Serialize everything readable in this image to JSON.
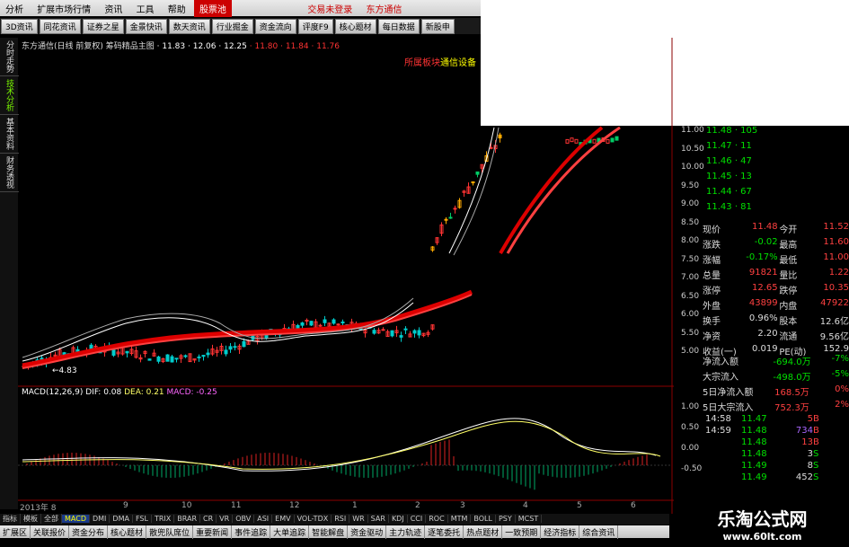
{
  "menubar": {
    "items": [
      "分析",
      "扩展市场行情",
      "资讯",
      "工具",
      "帮助"
    ],
    "highlight": "股票池",
    "right_items": [
      "交易未登录",
      "东方通信"
    ]
  },
  "tabs": [
    "3D资讯",
    "同花资讯",
    "证券之星",
    "金景快讯",
    "数天资讯",
    "行业掘金",
    "资金流向",
    "评度F9",
    "核心题材",
    "每日数据",
    "新股申"
  ],
  "sidebar": {
    "items": [
      "分时走势",
      "技术分析",
      "基本资料",
      "财务透视"
    ],
    "active_index": 1
  },
  "chart": {
    "title": "东方通信(日线 前复权) 筹码精品主图",
    "ma_values": [
      "11.83",
      "12.06",
      "12.25"
    ],
    "ma_values_red": [
      "11.80",
      "11.84",
      "11.76"
    ],
    "annotation_red": "所属板块",
    "annotation_yellow": "通信设备",
    "low_marker": "←4.83",
    "price_axis": [
      "11.00",
      "10.50",
      "10.00",
      "9.50",
      "9.00",
      "8.50",
      "8.00",
      "7.50",
      "7.00",
      "6.50",
      "6.00",
      "5.50",
      "5.00"
    ],
    "macd_label": "MACD(12,26,9)",
    "macd_dif": "DIF: 0.08",
    "macd_dea": "DEA: 0.21",
    "macd_val": "MACD: -0.25",
    "macd_axis": [
      "1.00",
      "0.50",
      "0.00",
      "-0.50"
    ],
    "date_axis": [
      "2013年 8",
      "9",
      "10",
      "11",
      "12",
      "1",
      "2",
      "3",
      "4",
      "5",
      "6"
    ]
  },
  "orderbook": {
    "rows": [
      {
        "price": "11.48",
        "vol": "105"
      },
      {
        "price": "11.47",
        "vol": "11"
      },
      {
        "price": "11.46",
        "vol": "47"
      },
      {
        "price": "11.45",
        "vol": "13"
      },
      {
        "price": "11.44",
        "vol": "67"
      },
      {
        "price": "11.43",
        "vol": "81"
      }
    ]
  },
  "quote": [
    [
      "现价",
      "11.48",
      "今开",
      "11.52"
    ],
    [
      "涨跌",
      "-0.02",
      "最高",
      "11.60"
    ],
    [
      "涨幅",
      "-0.17%",
      "最低",
      "11.00"
    ],
    [
      "总量",
      "91821",
      "量比",
      "1.22"
    ],
    [
      "涨停",
      "12.65",
      "跌停",
      "10.35"
    ],
    [
      "外盘",
      "43899",
      "内盘",
      "47922"
    ],
    [
      "换手",
      "0.96%",
      "股本",
      "12.6亿"
    ],
    [
      "净资",
      "2.20",
      "流通",
      "9.56亿"
    ],
    [
      "收益(一)",
      "0.019",
      "PE(动)",
      "152.9"
    ]
  ],
  "flows": [
    [
      "净流入额",
      "-694.0万",
      "-7%"
    ],
    [
      "大宗流入",
      "-498.0万",
      "-5%"
    ],
    [
      "5日净流入额",
      "168.5万",
      "0%"
    ],
    [
      "5日大宗流入",
      "752.3万",
      "2%"
    ]
  ],
  "trades": [
    [
      "14:58",
      "11.47",
      "5",
      "B"
    ],
    [
      "14:59",
      "11.48",
      "734",
      "B"
    ],
    [
      "",
      "11.48",
      "13",
      "B"
    ],
    [
      "",
      "11.48",
      "3",
      "S"
    ],
    [
      "",
      "11.49",
      "8",
      "S"
    ],
    [
      "",
      "11.49",
      "452",
      "S"
    ]
  ],
  "indicator_tabs": [
    "指标",
    "模板",
    "全部",
    "MACD",
    "DMI",
    "DMA",
    "FSL",
    "TRIX",
    "BRAR",
    "CR",
    "VR",
    "OBV",
    "ASI",
    "EMV",
    "VOL-TDX",
    "RSI",
    "WR",
    "SAR",
    "KDJ",
    "CCI",
    "ROC",
    "MTM",
    "BOLL",
    "PSY",
    "MCST"
  ],
  "bottom_tabs": [
    "扩展区",
    "关联报价",
    "资金分布",
    "核心题材",
    "散兜队席位",
    "重要新闻",
    "事件追踪",
    "大单追踪",
    "智能解盘",
    "资金驱动",
    "主力轨迹",
    "逐笔委托",
    "热点题材",
    "一致预期",
    "经济指标",
    "综合资讯"
  ],
  "watermark": {
    "title": "乐淘公式网",
    "url": "www.60lt.com"
  },
  "colors": {
    "up": "#ff3333",
    "down": "#00cc66",
    "ma_red": "#dd0000",
    "yellow": "#ffff00"
  }
}
